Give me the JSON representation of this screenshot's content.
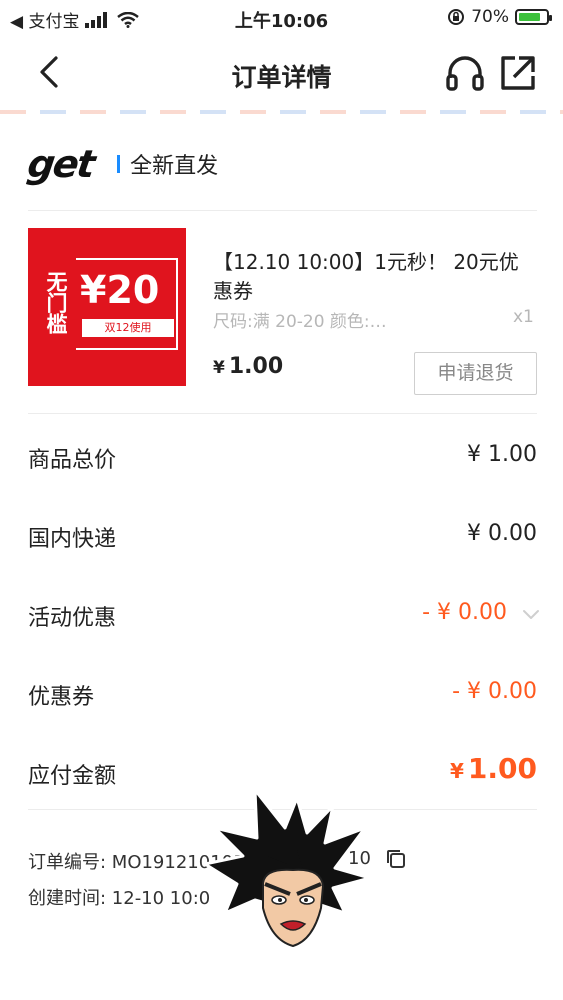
{
  "status_bar": {
    "back_app": "◀ 支付宝",
    "time": "上午10:06",
    "battery": "70%"
  },
  "nav": {
    "title": "订单详情"
  },
  "shop": {
    "logo": "get",
    "name": "全新直发"
  },
  "product": {
    "image_side_text": "无门槛",
    "image_amount": "¥20",
    "image_badge": "双12使用",
    "title": "【12.10 10:00】1元秒！ 20元优惠券",
    "spec": "尺码:满 20-20 颜色:…",
    "quantity": "x1",
    "currency": "¥",
    "price": "1.00",
    "refund_button": "申请退货"
  },
  "summary": {
    "items_total_label": "商品总价",
    "items_total_value": "¥ 1.00",
    "shipping_label": "国内快递",
    "shipping_value": "¥ 0.00",
    "promotion_label": "活动优惠",
    "promotion_value": "- ¥ 0.00",
    "coupon_label": "优惠券",
    "coupon_value": "- ¥ 0.00",
    "payable_label": "应付金额",
    "payable_currency": "¥",
    "payable_value": "1.00"
  },
  "order": {
    "order_no": "订单编号: MO1912101010",
    "order_no_tail": "10",
    "created": "创建时间: 12-10 10:0"
  },
  "colors": {
    "accent_orange": "#ff5a1f",
    "brand_red": "#e0141e",
    "shop_separator_blue": "#1a8cff"
  },
  "icons": {
    "back": "chevron-left-icon",
    "service": "headset-icon",
    "share": "share-icon",
    "copy": "copy-icon",
    "expand": "chevron-down-icon"
  }
}
